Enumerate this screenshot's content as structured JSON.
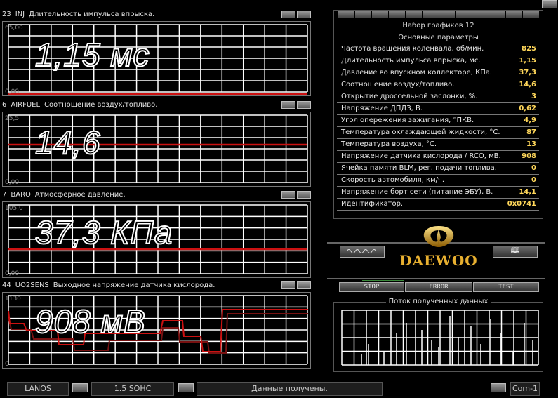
{
  "graphs": [
    {
      "num": "23",
      "code": "INJ",
      "desc": "Длительность импульса впрыска.",
      "ymax": "65,00",
      "ymin": "0,00",
      "value": "1,15 мс"
    },
    {
      "num": "6",
      "code": "AIRFUEL",
      "desc": "Соотношение воздух/топливо.",
      "ymax": "25,5",
      "ymin": "0,00",
      "value": "14,6"
    },
    {
      "num": "7",
      "code": "BARO",
      "desc": "Атмосферное давление.",
      "ymax": "105,0",
      "ymin": "0,00",
      "value": "37,3 КПа"
    },
    {
      "num": "44",
      "code": "UO2SENS",
      "desc": "Выходное напряжение датчика кислорода.",
      "ymax": "1130",
      "ymin": "0",
      "value": "908 мВ"
    }
  ],
  "params": {
    "set_title": "Набор графиков 12",
    "section_title": "Основные параметры",
    "rows": [
      {
        "label": "Частота вращения коленвала, об/мин.",
        "value": "825"
      },
      {
        "label": "Длительность импульса впрыска, мс.",
        "value": "1,15"
      },
      {
        "label": "Давление во впускном коллекторе, КПа.",
        "value": "37,3"
      },
      {
        "label": "Соотношение воздух/топливо.",
        "value": "14,6"
      },
      {
        "label": "Открытие дроссельной заслонки, %.",
        "value": "3"
      },
      {
        "label": "Напряжение ДПДЗ, В.",
        "value": "0,62"
      },
      {
        "label": "Угол опережения зажигания, °ПКВ.",
        "value": "4,9"
      },
      {
        "label": "Температура охлаждающей жидкости, °С.",
        "value": "87"
      },
      {
        "label": "Температура воздуха, °С.",
        "value": "13"
      },
      {
        "label": "Напряжение датчика кислорода / RCO, мВ.",
        "value": "908"
      },
      {
        "label": "Ячейка памяти BLM, рег. подачи топлива.",
        "value": "0"
      },
      {
        "label": "Скорость автомобиля, км/ч.",
        "value": "0"
      },
      {
        "label": "Напряжение борт сети (питание ЭБУ), В.",
        "value": "14,1"
      },
      {
        "label": "Идентификатор.",
        "value": "0x0741"
      }
    ]
  },
  "logo": "DAEWOO",
  "controls": {
    "stop": "STOP",
    "error": "ERROR",
    "test": "TEST",
    "book_icon": "book-icon"
  },
  "stream_title": "Поток полученных данных",
  "status": {
    "car": "LANOS",
    "engine": "1.5 SOHC",
    "message": "Данные получены.",
    "port": "Com-1"
  },
  "colors": {
    "trace": "#cc1111",
    "grid": "#ffffff",
    "value_text": "#ffd75a"
  }
}
